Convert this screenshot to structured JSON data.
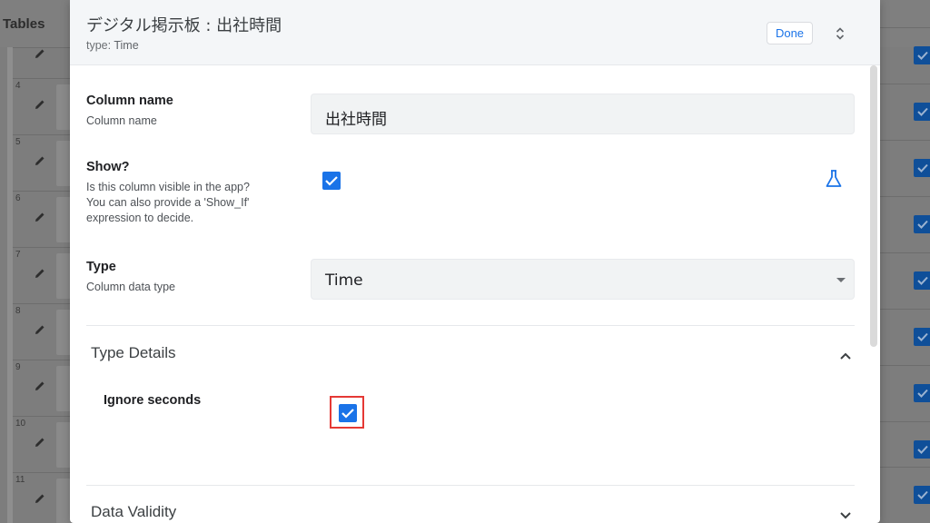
{
  "background": {
    "tables_label": "Tables",
    "row_numbers": [
      "4",
      "5",
      "6",
      "7",
      "8",
      "9",
      "10",
      "11"
    ]
  },
  "dialog": {
    "title": "デジタル掲示板 : 出社時間",
    "subtitle_key": "type:",
    "subtitle_value": "Time",
    "done_label": "Done"
  },
  "fields": {
    "column_name": {
      "label": "Column name",
      "description": "Column name",
      "value": "出社時間"
    },
    "show": {
      "label": "Show?",
      "description_lines": [
        "Is this column visible in the app?",
        "You can also provide a 'Show_If'",
        "expression to decide."
      ],
      "checked": true
    },
    "type": {
      "label": "Type",
      "description": "Column data type",
      "value": "Time"
    }
  },
  "sections": {
    "type_details": {
      "title": "Type Details",
      "ignore_seconds_label": "Ignore seconds",
      "ignore_seconds_checked": true
    },
    "data_validity": {
      "title": "Data Validity"
    }
  },
  "colors": {
    "accent": "#1a73e8",
    "highlight": "#e53935"
  }
}
